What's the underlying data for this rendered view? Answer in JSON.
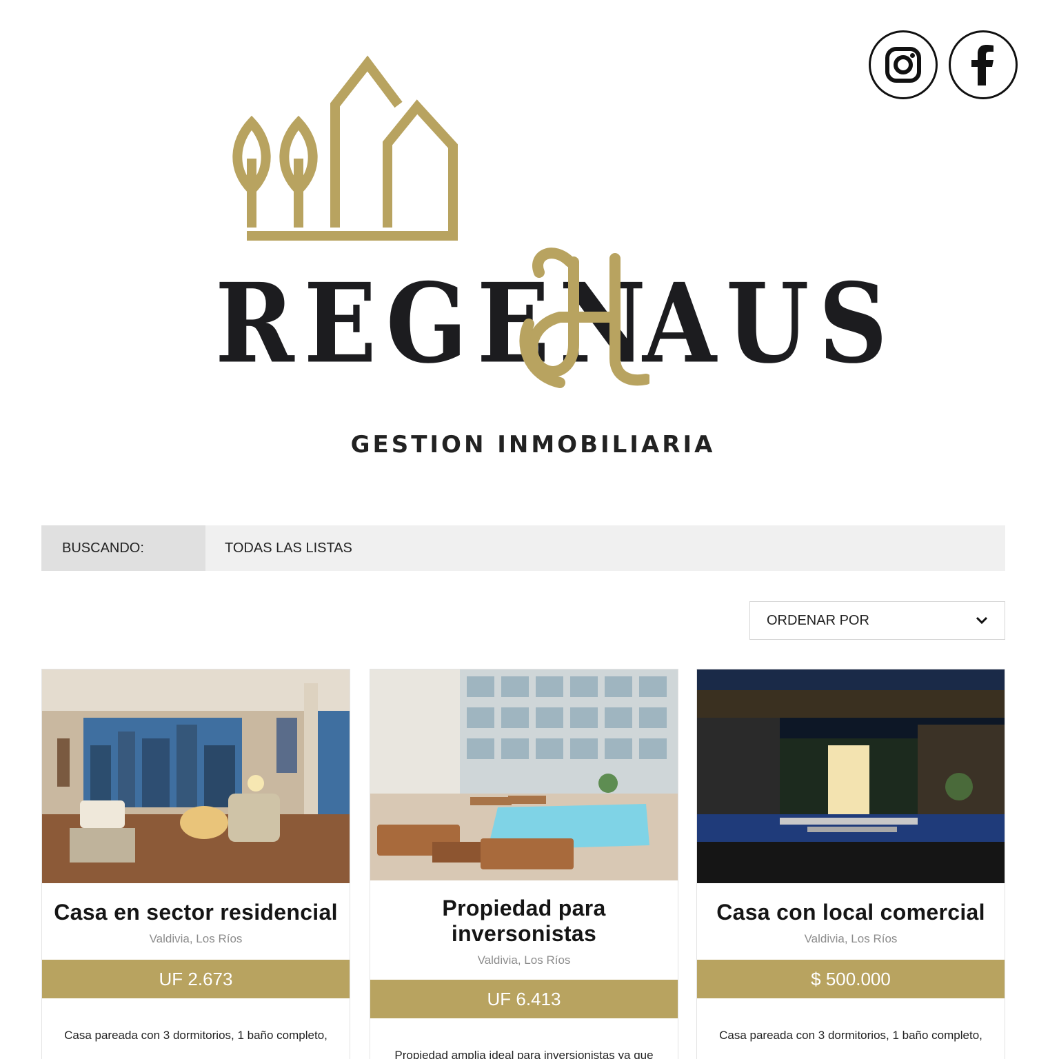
{
  "brand": {
    "name_left": "REGEN",
    "name_right": "AUS",
    "tagline": "GESTION INMOBILIARIA",
    "gold": "#b8a360",
    "dark": "#1c1c1f"
  },
  "social": [
    {
      "icon": "instagram-icon"
    },
    {
      "icon": "facebook-icon"
    }
  ],
  "search": {
    "label": "BUSCANDO:",
    "value": "TODAS LAS LISTAS"
  },
  "sort": {
    "label": "ORDENAR POR",
    "icon": "chevron-down-icon"
  },
  "listings": [
    {
      "title": "Casa en sector residencial",
      "location": "Valdivia, Los Ríos",
      "price": "UF 2.673",
      "description": "Casa pareada con 3 dormitorios, 1 baño completo,"
    },
    {
      "title": "Propiedad para inversonistas",
      "location": "Valdivia, Los Ríos",
      "price": "UF 6.413",
      "description": "Propiedad amplia ideal para inversionistas ya que"
    },
    {
      "title": "Casa con local comercial",
      "location": "Valdivia, Los Ríos",
      "price": "$ 500.000",
      "description": "Casa pareada con 3 dormitorios, 1 baño completo,"
    }
  ]
}
